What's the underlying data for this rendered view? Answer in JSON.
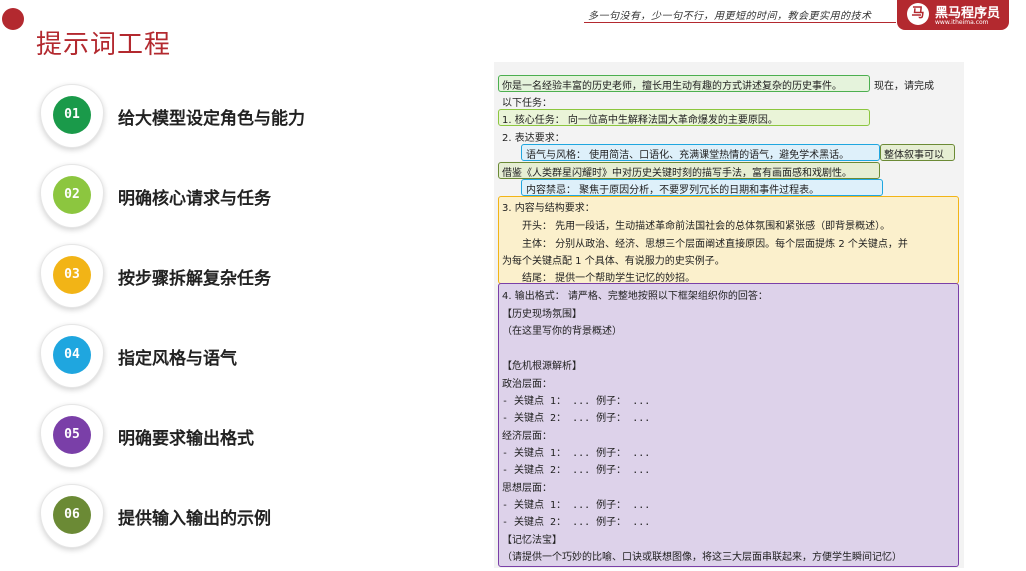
{
  "header": {
    "title": "提示词工程",
    "slogan": "多一句没有，少一句不行，用更短的时间，教会更实用的技术",
    "logo_name": "黑马程序员",
    "logo_sub": "www.itheima.com",
    "logo_mark": "马"
  },
  "steps": [
    {
      "num": "01",
      "label": "给大模型设定角色与能力",
      "color": "#1a9a4a"
    },
    {
      "num": "02",
      "label": "明确核心请求与任务",
      "color": "#8cc63f"
    },
    {
      "num": "03",
      "label": "按步骤拆解复杂任务",
      "color": "#f2b416"
    },
    {
      "num": "04",
      "label": "指定风格与语气",
      "color": "#1fa6df"
    },
    {
      "num": "05",
      "label": "明确要求输出格式",
      "color": "#7a3fa8"
    },
    {
      "num": "06",
      "label": "提供输入输出的示例",
      "color": "#6b8a35"
    }
  ],
  "prompt": {
    "l1a": "你是一名经验丰富的历史老师，擅长用生动有趣的方式讲述复杂的历史事件。",
    "l1b": "现在，请完成",
    "l2": "以下任务：",
    "l3": "1.  核心任务： 向一位高中生解释法国大革命爆发的主要原因。",
    "l4": "2.  表达要求：",
    "l5a": "语气与风格： 使用简洁、口语化、充满课堂热情的语气，避免学术黑话。",
    "l5b": "整体叙事可以",
    "l6": "借鉴《人类群星闪耀时》中对历史关键时刻的描写手法，富有画面感和戏剧性。",
    "l7": "内容禁忌： 聚焦于原因分析，不要罗列冗长的日期和事件过程表。",
    "l8": "3.  内容与结构要求：",
    "l9": "开头： 先用一段话，生动描述革命前法国社会的总体氛围和紧张感（即背景概述）。",
    "l10": "主体： 分别从政治、经济、思想三个层面阐述直接原因。每个层面提炼 2 个关键点，并",
    "l11": "为每个关键点配 1 个具体、有说服力的史实例子。",
    "l12": "结尾： 提供一个帮助学生记忆的妙招。",
    "l13": "4.  输出格式： 请严格、完整地按照以下框架组织你的回答：",
    "l14": "【历史现场氛围】",
    "l15": "（在这里写你的背景概述）",
    "l16": "【危机根源解析】",
    "l17": "政治层面：",
    "l18": "  -  关键点 1： ...  例子： ...",
    "l19": "  -  关键点 2： ...  例子： ...",
    "l20": "经济层面：",
    "l21": "  -  关键点 1： ...  例子： ...",
    "l22": "  -  关键点 2： ...  例子： ...",
    "l23": "思想层面：",
    "l24": "  -  关键点 1： ...  例子： ...",
    "l25": "  -  关键点 2： ...  例子： ...",
    "l26": "【记忆法宝】",
    "l27": "（请提供一个巧妙的比喻、口诀或联想图像，将这三大层面串联起来，方便学生瞬间记忆）"
  }
}
